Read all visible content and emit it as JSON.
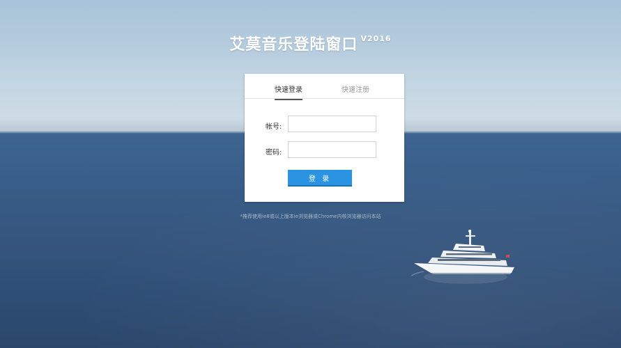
{
  "header": {
    "title": "艾莫音乐登陆窗口",
    "version": "V2016"
  },
  "login": {
    "tabs": [
      {
        "label": "快速登录",
        "active": true
      },
      {
        "label": "快速注册",
        "active": false
      }
    ],
    "username_label": "帐号:",
    "username_value": "",
    "password_label": "密码:",
    "password_value": "",
    "submit_label": "登 录"
  },
  "footer": {
    "hint": "*推荐使用ie8或以上版本ie浏览器或Chrome内核浏览器访问本站"
  },
  "colors": {
    "accent": "#2a93e2",
    "sky": "#b3cbdd",
    "sea": "#375a84"
  },
  "icons": [
    "yacht-image"
  ]
}
